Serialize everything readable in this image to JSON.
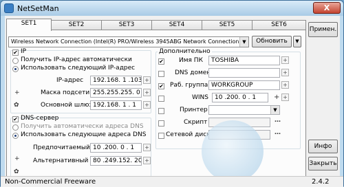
{
  "window": {
    "title": "NetSetMan",
    "close_label": "X"
  },
  "tabs": [
    "SET1",
    "SET2",
    "SET3",
    "SET4",
    "SET5",
    "SET6"
  ],
  "adapter": {
    "value": "Wireless Network Connection (Intel(R) PRO/Wireless 3945ABG Network Connection)",
    "refresh_label": "Обновить"
  },
  "ip": {
    "group_label": "IP",
    "auto_label": "Получить IP-адрес автоматически",
    "manual_label": "Использовать следующий IP-адрес",
    "address_label": "IP-адрес",
    "address_value": "192.168. 1 .103",
    "mask_label": "Маска подсети",
    "mask_value": "255.255.255. 0",
    "gateway_label": "Основной шлюз",
    "gateway_value": "192.168. 1 . 1"
  },
  "dns": {
    "group_label": "DNS-сервер",
    "auto_label": "Получить автоматически адреса DNS",
    "manual_label": "Использовать следующие адреса DNS",
    "preferred_label": "Предпочитаемый",
    "preferred_value": "10 .200. 0 . 1",
    "alternate_label": "Альтернативный",
    "alternate_value": "80 .249.152. 20"
  },
  "additional": {
    "group_label": "Дополнительно",
    "pc_name_label": "Имя ПК",
    "pc_name_value": "TOSHIBA",
    "dns_domain_label": "DNS домен",
    "workgroup_label": "Раб. группа",
    "workgroup_value": "WORKGROUP",
    "wins_label": "WINS",
    "wins_value": "10 .200. 0 . 1",
    "printer_label": "Принтер",
    "script_label": "Скрипт",
    "netdisk_label": "Сетевой диск"
  },
  "buttons": {
    "apply": "Примен.",
    "info": "Инфо",
    "close": "Закрыть"
  },
  "status": {
    "left": "Non-Commercial Freeware",
    "version": "2.4.2"
  }
}
